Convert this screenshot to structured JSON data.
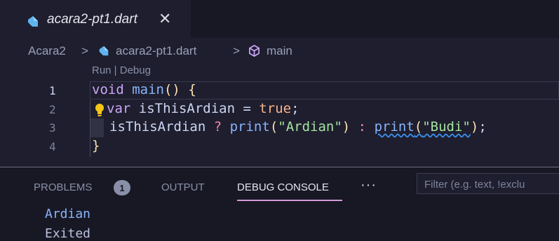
{
  "tab": {
    "label": "acara2-pt1.dart",
    "close_glyph": "✕",
    "icon": "dart-icon"
  },
  "breadcrumb": {
    "folder": "Acara2",
    "sep1": ">",
    "file": "acara2-pt1.dart",
    "sep2": ">",
    "symbol": "main"
  },
  "editor": {
    "codelens": "Run | Debug",
    "line_numbers": [
      "1",
      "2",
      "3",
      "4"
    ],
    "lines": {
      "l1": {
        "kw": "void",
        "fn": "main",
        "p1": "()",
        "p2": " {"
      },
      "l2": {
        "kw": "var",
        "id": " isThisArdian = ",
        "bool": "true",
        "end": ";"
      },
      "l3": {
        "id": "isThisArdian ",
        "tern": "?",
        "fn1": " print",
        "p1": "(",
        "s1": "\"Ardian\"",
        "p2": ")",
        "colon": " : ",
        "fn2": "print",
        "p3": "(",
        "s2": "\"Budi\"",
        "p4": ")",
        "end": ";"
      },
      "l4": {
        "brace": "}"
      }
    }
  },
  "panel": {
    "tabs": [
      "PROBLEMS",
      "OUTPUT",
      "DEBUG CONSOLE"
    ],
    "problems_count": "1",
    "more": "···",
    "filter_placeholder": "Filter (e.g. text, !exclu",
    "console_lines": [
      "Ardian",
      "Exited"
    ]
  },
  "colors": {
    "background": "#1e1e2e",
    "accent_tab_underline": "#d29bd8",
    "keyword": "#cba6f7",
    "string": "#a6e3a1"
  }
}
